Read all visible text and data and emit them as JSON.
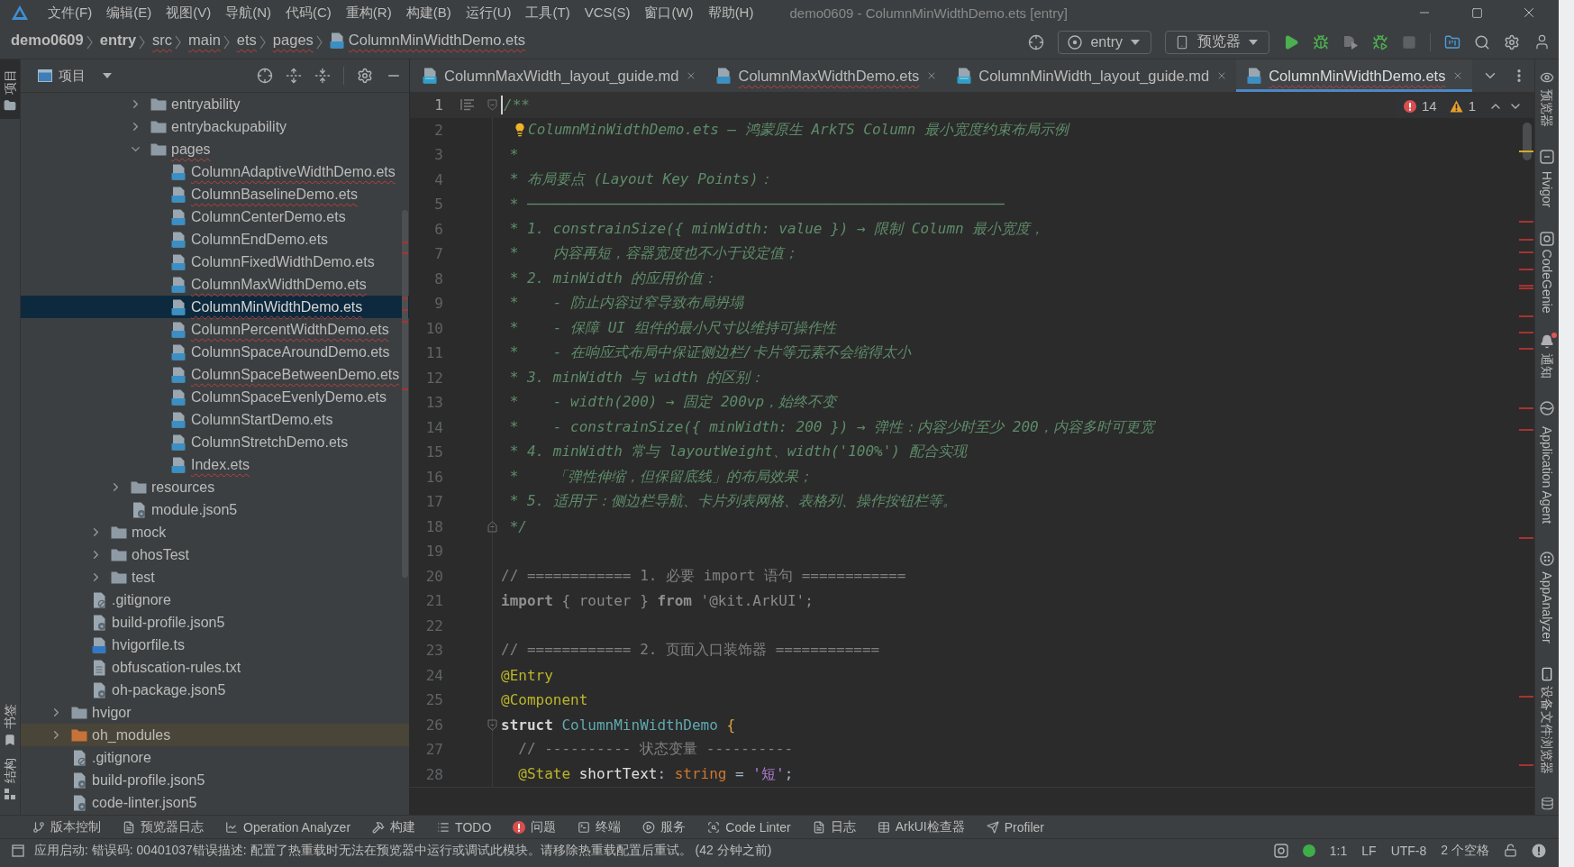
{
  "window": {
    "title": "demo0609 - ColumnMinWidthDemo.ets [entry]"
  },
  "menu": [
    "文件(F)",
    "编辑(E)",
    "视图(V)",
    "导航(N)",
    "代码(C)",
    "重构(R)",
    "构建(B)",
    "运行(U)",
    "工具(T)",
    "VCS(S)",
    "窗口(W)",
    "帮助(H)"
  ],
  "breadcrumb": [
    {
      "label": "demo0609",
      "kind": "project",
      "error": false
    },
    {
      "label": "entry",
      "kind": "module",
      "error": false
    },
    {
      "label": "src",
      "kind": "folder",
      "error": true
    },
    {
      "label": "main",
      "kind": "folder",
      "error": true
    },
    {
      "label": "ets",
      "kind": "folder",
      "error": true
    },
    {
      "label": "pages",
      "kind": "folder",
      "error": true
    },
    {
      "label": "ColumnMinWidthDemo.ets",
      "kind": "file",
      "error": true
    }
  ],
  "toolbar": {
    "run_config": "entry",
    "device": "预览器"
  },
  "left_strip": [
    {
      "label": "项目",
      "selected": true
    },
    {
      "label": "书签",
      "selected": false
    },
    {
      "label": "结构",
      "selected": false
    }
  ],
  "project_panel": {
    "title": "项目",
    "tree": [
      {
        "children": [
          {
            "children": [
              {
                "children": [
                  {
                    "children": [
                      {
                        "label": "entryability",
                        "kind": "folder",
                        "expanded": false,
                        "error": false,
                        "selected": false
                      },
                      {
                        "label": "entrybackupability",
                        "kind": "folder",
                        "expanded": false,
                        "error": false,
                        "selected": false
                      },
                      {
                        "label": "pages",
                        "kind": "folder",
                        "expanded": true,
                        "error": true,
                        "selected": false,
                        "children": [
                          {
                            "label": "ColumnAdaptiveWidthDemo.ets",
                            "kind": "ets",
                            "error": true,
                            "selected": false
                          },
                          {
                            "label": "ColumnBaselineDemo.ets",
                            "kind": "ets",
                            "error": true,
                            "selected": false
                          },
                          {
                            "label": "ColumnCenterDemo.ets",
                            "kind": "ets",
                            "error": false,
                            "selected": false
                          },
                          {
                            "label": "ColumnEndDemo.ets",
                            "kind": "ets",
                            "error": false,
                            "selected": false
                          },
                          {
                            "label": "ColumnFixedWidthDemo.ets",
                            "kind": "ets",
                            "error": false,
                            "selected": false
                          },
                          {
                            "label": "ColumnMaxWidthDemo.ets",
                            "kind": "ets",
                            "error": true,
                            "selected": false
                          },
                          {
                            "label": "ColumnMinWidthDemo.ets",
                            "kind": "ets",
                            "error": true,
                            "selected": true
                          },
                          {
                            "label": "ColumnPercentWidthDemo.ets",
                            "kind": "ets",
                            "error": true,
                            "selected": false
                          },
                          {
                            "label": "ColumnSpaceAroundDemo.ets",
                            "kind": "ets",
                            "error": false,
                            "selected": false
                          },
                          {
                            "label": "ColumnSpaceBetweenDemo.ets",
                            "kind": "ets",
                            "error": true,
                            "selected": false
                          },
                          {
                            "label": "ColumnSpaceEvenlyDemo.ets",
                            "kind": "ets",
                            "error": false,
                            "selected": false
                          },
                          {
                            "label": "ColumnStartDemo.ets",
                            "kind": "ets",
                            "error": false,
                            "selected": false
                          },
                          {
                            "label": "ColumnStretchDemo.ets",
                            "kind": "ets",
                            "error": false,
                            "selected": false
                          },
                          {
                            "label": "Index.ets",
                            "kind": "ets",
                            "error": true,
                            "selected": false
                          }
                        ]
                      }
                    ]
                  },
                  {
                    "label": "resources",
                    "kind": "folder",
                    "expanded": false,
                    "error": false,
                    "selected": false
                  },
                  {
                    "label": "module.json5",
                    "kind": "json5",
                    "error": false,
                    "selected": false
                  }
                ]
              },
              {
                "label": "mock",
                "kind": "folder",
                "expanded": false,
                "error": false,
                "selected": false
              },
              {
                "label": "ohosTest",
                "kind": "folder",
                "expanded": false,
                "error": false,
                "selected": false
              },
              {
                "label": "test",
                "kind": "folder",
                "expanded": false,
                "error": false,
                "selected": false
              }
            ]
          },
          {
            "label": ".gitignore",
            "kind": "gitignore",
            "error": false,
            "selected": false
          },
          {
            "label": "build-profile.json5",
            "kind": "json5",
            "error": false,
            "selected": false
          },
          {
            "label": "hvigorfile.ts",
            "kind": "ts",
            "error": false,
            "selected": false
          },
          {
            "label": "obfuscation-rules.txt",
            "kind": "txt",
            "error": false,
            "selected": false
          },
          {
            "label": "oh-package.json5",
            "kind": "json5",
            "error": false,
            "selected": false
          }
        ]
      },
      {
        "label": "hvigor",
        "kind": "folder",
        "expanded": false,
        "error": false,
        "selected": false
      },
      {
        "label": "oh_modules",
        "kind": "library_folder",
        "expanded": false,
        "error": false,
        "selected": false
      },
      {
        "label": ".gitignore",
        "kind": "gitignore",
        "error": false,
        "selected": false
      },
      {
        "label": "build-profile.json5",
        "kind": "json5",
        "error": false,
        "selected": false
      },
      {
        "label": "code-linter.json5",
        "kind": "json5",
        "error": false,
        "selected": false
      }
    ]
  },
  "editor_tabs": [
    {
      "label": "ColumnMaxWidth_layout_guide.md",
      "kind": "md",
      "error": false,
      "selected": false
    },
    {
      "label": "ColumnMaxWidthDemo.ets",
      "kind": "ets",
      "error": true,
      "selected": false
    },
    {
      "label": "ColumnMinWidth_layout_guide.md",
      "kind": "md",
      "error": false,
      "selected": false
    },
    {
      "label": "ColumnMinWidthDemo.ets",
      "kind": "ets",
      "error": true,
      "selected": true
    }
  ],
  "editor": {
    "errors": "14",
    "warnings": "1",
    "lines": [
      {
        "n": "1",
        "current": true,
        "fold_start": true,
        "tokens": [
          {
            "text": "/**",
            "kind": "doc"
          }
        ]
      },
      {
        "n": "2",
        "current": false,
        "tokens": [
          {
            "kind": "bulb"
          },
          {
            "text": "ColumnMinWidthDemo.ets — 鸿蒙原生 ArkTS Column 最小宽度约束布局示例",
            "kind": "doc"
          }
        ]
      },
      {
        "n": "3",
        "current": false,
        "tokens": [
          {
            "text": " *",
            "kind": "doc"
          }
        ]
      },
      {
        "n": "4",
        "current": false,
        "tokens": [
          {
            "text": " * 布局要点 (Layout Key Points)：",
            "kind": "doc"
          }
        ]
      },
      {
        "n": "5",
        "current": false,
        "tokens": [
          {
            "text": " * ───────────────────────────────────────────────────────",
            "kind": "doc"
          }
        ]
      },
      {
        "n": "6",
        "current": false,
        "tokens": [
          {
            "text": " * 1. constrainSize({ minWidth: value }) → 限制 Column 最小宽度，",
            "kind": "doc"
          }
        ]
      },
      {
        "n": "7",
        "current": false,
        "tokens": [
          {
            "text": " *    内容再短，容器宽度也不小于设定值；",
            "kind": "doc"
          }
        ]
      },
      {
        "n": "8",
        "current": false,
        "tokens": [
          {
            "text": " * 2. minWidth 的应用价值：",
            "kind": "doc"
          }
        ]
      },
      {
        "n": "9",
        "current": false,
        "tokens": [
          {
            "text": " *    - 防止内容过窄导致布局坍塌",
            "kind": "doc"
          }
        ]
      },
      {
        "n": "10",
        "current": false,
        "tokens": [
          {
            "text": " *    - 保障 UI 组件的最小尺寸以维持可操作性",
            "kind": "doc"
          }
        ]
      },
      {
        "n": "11",
        "current": false,
        "tokens": [
          {
            "text": " *    - 在响应式布局中保证侧边栏/卡片等元素不会缩得太小",
            "kind": "doc"
          }
        ]
      },
      {
        "n": "12",
        "current": false,
        "tokens": [
          {
            "text": " * 3. minWidth 与 width 的区别：",
            "kind": "doc"
          }
        ]
      },
      {
        "n": "13",
        "current": false,
        "tokens": [
          {
            "text": " *    - width(200) → 固定 200vp，始终不变",
            "kind": "doc"
          }
        ]
      },
      {
        "n": "14",
        "current": false,
        "tokens": [
          {
            "text": " *    - constrainSize({ minWidth: 200 }) → 弹性：内容少时至少 200，内容多时可更宽",
            "kind": "doc"
          }
        ]
      },
      {
        "n": "15",
        "current": false,
        "tokens": [
          {
            "text": " * 4. minWidth 常与 layoutWeight、width('100%') 配合实现",
            "kind": "doc"
          }
        ]
      },
      {
        "n": "16",
        "current": false,
        "tokens": [
          {
            "text": " *    「弹性伸缩，但保留底线」的布局效果；",
            "kind": "doc"
          }
        ]
      },
      {
        "n": "17",
        "current": false,
        "tokens": [
          {
            "text": " * 5. 适用于：侧边栏导航、卡片列表网格、表格列、操作按钮栏等。",
            "kind": "doc"
          }
        ]
      },
      {
        "n": "18",
        "current": false,
        "fold_end": true,
        "tokens": [
          {
            "text": " */",
            "kind": "doc"
          }
        ]
      },
      {
        "n": "19",
        "current": false
      },
      {
        "n": "20",
        "current": false,
        "tokens": [
          {
            "text": "// ============ 1. 必要 import 语句 ============",
            "kind": "comment"
          }
        ]
      },
      {
        "n": "21",
        "current": false,
        "tokens": [
          {
            "text": "import",
            "kind": "dim_keyword"
          },
          {
            "text": " { router } ",
            "kind": "dim"
          },
          {
            "text": "from",
            "kind": "dim_keyword"
          },
          {
            "text": " '@kit.ArkUI';",
            "kind": "dim"
          }
        ]
      },
      {
        "n": "22",
        "current": false
      },
      {
        "n": "23",
        "current": false,
        "tokens": [
          {
            "text": "// ============ 2. 页面入口装饰器 ============",
            "kind": "comment"
          }
        ]
      },
      {
        "n": "24",
        "current": false,
        "tokens": [
          {
            "text": "@Entry",
            "kind": "annotation"
          }
        ]
      },
      {
        "n": "25",
        "current": false,
        "tokens": [
          {
            "text": "@Component",
            "kind": "annotation"
          }
        ]
      },
      {
        "n": "26",
        "current": false,
        "fold_start": true,
        "tokens": [
          {
            "text": "struct",
            "kind": "keyword"
          },
          {
            "text": " ColumnMinWidthDemo ",
            "kind": "class_name"
          },
          {
            "text": "{",
            "kind": "brace"
          }
        ]
      },
      {
        "n": "27",
        "current": false,
        "tokens": [
          {
            "text": "  // ---------- 状态变量 ----------",
            "kind": "comment"
          }
        ]
      },
      {
        "n": "28",
        "current": false,
        "tokens": [
          {
            "text": "  @State",
            "kind": "annotation"
          },
          {
            "text": " shortText",
            "kind": "field"
          },
          {
            "text": ": ",
            "kind": "plain"
          },
          {
            "text": "string",
            "kind": "type"
          },
          {
            "text": " = ",
            "kind": "plain"
          },
          {
            "text": "'短'",
            "kind": "string"
          },
          {
            "text": ";",
            "kind": "plain"
          }
        ]
      }
    ]
  },
  "right_strip": [
    {
      "label": "预览器",
      "selected": false,
      "badge": false
    },
    {
      "label": "Hvigor",
      "selected": false,
      "badge": false
    },
    {
      "label": "CodeGenie",
      "selected": false,
      "badge": false
    },
    {
      "label": "通知",
      "selected": false,
      "badge": true
    },
    {
      "label": "Application Agent",
      "selected": false,
      "badge": false
    },
    {
      "label": "AppAnalyzer",
      "selected": false,
      "badge": false
    },
    {
      "label": "设备文件浏览器",
      "selected": false,
      "badge": false
    }
  ],
  "tool_windows": [
    {
      "label": "版本控制",
      "selected": false
    },
    {
      "label": "预览器日志",
      "selected": false
    },
    {
      "label": "Operation Analyzer",
      "selected": false
    },
    {
      "label": "构建",
      "selected": false
    },
    {
      "label": "TODO",
      "selected": false
    },
    {
      "label": "问题",
      "selected": false
    },
    {
      "label": "终端",
      "selected": false
    },
    {
      "label": "服务",
      "selected": false
    },
    {
      "label": "Code Linter",
      "selected": false
    },
    {
      "label": "日志",
      "selected": false
    },
    {
      "label": "ArkUI检查器",
      "selected": false
    },
    {
      "label": "Profiler",
      "selected": false
    }
  ],
  "status_bar": {
    "message": "应用启动: 错误码: 00401037错误描述: 配置了热重载时无法在预览器中运行或调试此模块。请移除热重载配置后重试。 (42 分钟之前)",
    "position": "1:1",
    "line_separator": "LF",
    "encoding": "UTF-8",
    "indent": "2 个空格"
  }
}
